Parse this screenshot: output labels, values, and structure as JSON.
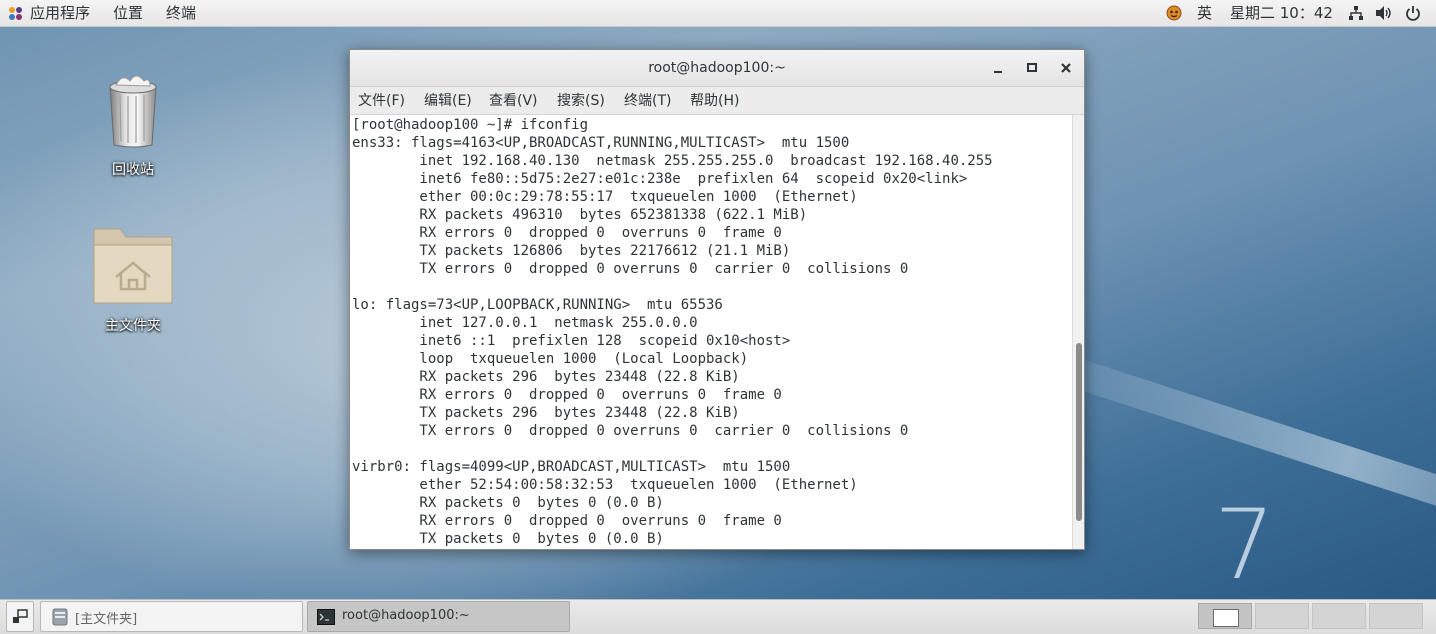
{
  "topbar": {
    "apps_label": "应用程序",
    "places_label": "位置",
    "terminal_label": "终端",
    "input_method": "英",
    "datetime": "星期二 10：42"
  },
  "desktop": {
    "trash_label": "回收站",
    "home_label": "主文件夹",
    "watermark": "7"
  },
  "terminal": {
    "title": "root@hadoop100:~",
    "menu": [
      "文件(F)",
      "编辑(E)",
      "查看(V)",
      "搜索(S)",
      "终端(T)",
      "帮助(H)"
    ],
    "lines": [
      "[root@hadoop100 ~]# ifconfig",
      "ens33: flags=4163<UP,BROADCAST,RUNNING,MULTICAST>  mtu 1500",
      "        inet 192.168.40.130  netmask 255.255.255.0  broadcast 192.168.40.255",
      "        inet6 fe80::5d75:2e27:e01c:238e  prefixlen 64  scopeid 0x20<link>",
      "        ether 00:0c:29:78:55:17  txqueuelen 1000  (Ethernet)",
      "        RX packets 496310  bytes 652381338 (622.1 MiB)",
      "        RX errors 0  dropped 0  overruns 0  frame 0",
      "        TX packets 126806  bytes 22176612 (21.1 MiB)",
      "        TX errors 0  dropped 0 overruns 0  carrier 0  collisions 0",
      "",
      "lo: flags=73<UP,LOOPBACK,RUNNING>  mtu 65536",
      "        inet 127.0.0.1  netmask 255.0.0.0",
      "        inet6 ::1  prefixlen 128  scopeid 0x10<host>",
      "        loop  txqueuelen 1000  (Local Loopback)",
      "        RX packets 296  bytes 23448 (22.8 KiB)",
      "        RX errors 0  dropped 0  overruns 0  frame 0",
      "        TX packets 296  bytes 23448 (22.8 KiB)",
      "        TX errors 0  dropped 0 overruns 0  carrier 0  collisions 0",
      "",
      "virbr0: flags=4099<UP,BROADCAST,MULTICAST>  mtu 1500",
      "        ether 52:54:00:58:32:53  txqueuelen 1000  (Ethernet)",
      "        RX packets 0  bytes 0 (0.0 B)",
      "        RX errors 0  dropped 0  overruns 0  frame 0",
      "        TX packets 0  bytes 0 (0.0 B)"
    ]
  },
  "taskbar": {
    "tasks": [
      {
        "label": "[主文件夹]",
        "icon": "file-manager-icon",
        "active": false
      },
      {
        "label": "root@hadoop100:~",
        "icon": "terminal-icon",
        "active": true
      }
    ],
    "workspaces": 4,
    "active_workspace": 1
  }
}
